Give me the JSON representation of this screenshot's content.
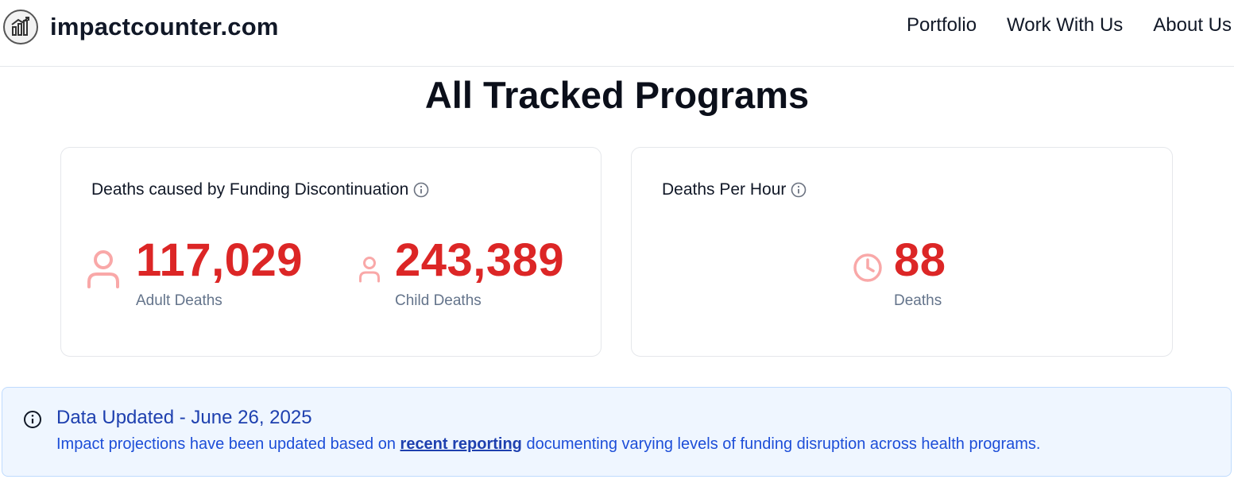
{
  "header": {
    "brand": "impactcounter.com",
    "logo_icon": "chart-logo-icon",
    "nav": [
      "Portfolio",
      "Work With Us",
      "About Us"
    ]
  },
  "page_title": "All Tracked Programs",
  "cards": {
    "funding": {
      "title": "Deaths caused by Funding Discontinuation",
      "info_icon": "info-icon",
      "adult": {
        "value": "117,029",
        "label": "Adult Deaths",
        "icon": "person-icon"
      },
      "child": {
        "value": "243,389",
        "label": "Child Deaths",
        "icon": "person-icon"
      }
    },
    "per_hour": {
      "title": "Deaths Per Hour",
      "info_icon": "info-icon",
      "value": "88",
      "label": "Deaths",
      "icon": "clock-icon"
    }
  },
  "banner": {
    "icon": "info-icon",
    "title": "Data Updated - June 26, 2025",
    "text_before": "Impact projections have been updated based on ",
    "link": "recent reporting",
    "text_after": " documenting varying levels of funding disruption across health programs."
  },
  "colors": {
    "accent_red": "#dc2626",
    "icon_pink": "#f9a8a8",
    "banner_bg": "#eff6ff",
    "banner_text": "#1d4ed8"
  }
}
